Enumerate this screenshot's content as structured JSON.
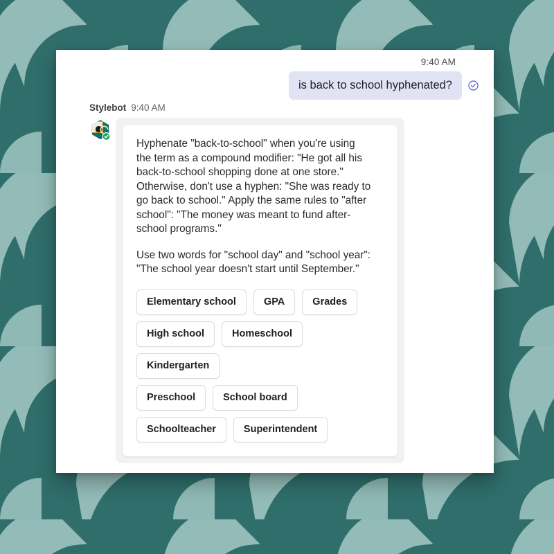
{
  "theme": {
    "page_background": "#2f6e6b",
    "pattern_shape_color": "#93bcb8",
    "window_background": "#ffffff",
    "user_bubble_color": "#e2e2f5",
    "panel_color": "#f1f2f3",
    "card_color": "#ffffff",
    "chip_border": "#dadce0",
    "sent_check_color": "#4f5bd5",
    "badge_color": "#1aa260"
  },
  "conversation": {
    "user_message": {
      "timestamp": "9:40 AM",
      "text": "is back to school hyphenated?",
      "status_icon": "check-circle-icon"
    },
    "bot_message": {
      "sender": "Stylebot",
      "timestamp": "9:40 AM",
      "avatar_icon": "stylebot-hexagon-avatar-icon",
      "verified_badge_icon": "verified-check-badge-icon",
      "paragraphs": [
        "Hyphenate \"back-to-school\" when you're using the term as a compound modifier: \"He got all his back-to-school shopping done at one store.\" Otherwise, don't use a hyphen: \"She was ready to go back to school.\" Apply the same rules to \"after school\": \"The money was meant to fund after-school programs.\"",
        "Use two words for \"school day\" and \"school year\": \"The school year doesn't start until September.\""
      ],
      "suggestion_rows": [
        [
          "Elementary school",
          "GPA",
          "Grades"
        ],
        [
          "High school",
          "Homeschool"
        ],
        [
          "Kindergarten"
        ],
        [
          "Preschool",
          "School board"
        ],
        [
          "Schoolteacher",
          "Superintendent"
        ]
      ]
    }
  }
}
